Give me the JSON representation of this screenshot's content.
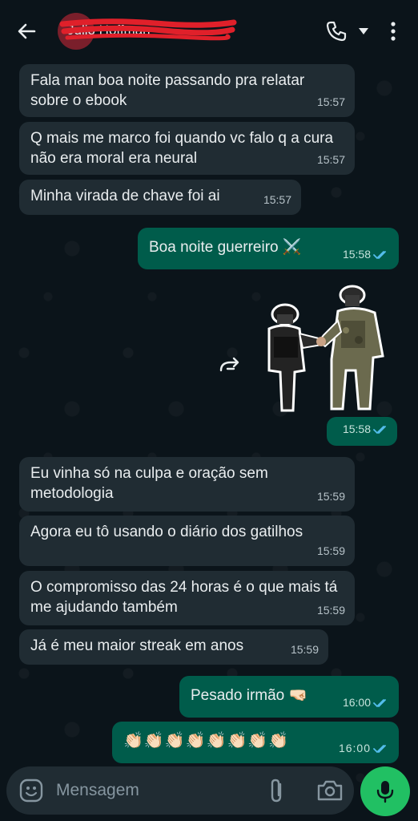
{
  "header": {
    "contact_name": "Julio Hoffman",
    "icons": [
      "back-arrow-icon",
      "phone-icon",
      "caret-down-icon",
      "more-vert-icon"
    ]
  },
  "messages": [
    {
      "dir": "in",
      "text": "Fala man boa noite passando pra relatar sobre o ebook",
      "time": "15:57"
    },
    {
      "dir": "in",
      "text": "Q mais me marco foi quando vc falo q a cura não era moral era neural",
      "time": "15:57"
    },
    {
      "dir": "in",
      "text": "Minha virada de chave foi ai",
      "time": "15:57"
    },
    {
      "dir": "out",
      "text": "Boa noite guerreiro ⚔️",
      "time": "15:58"
    },
    {
      "dir": "out",
      "type": "sticker",
      "time": "15:58"
    },
    {
      "dir": "in",
      "text": "Eu vinha só na culpa e oração sem metodologia",
      "time": "15:59"
    },
    {
      "dir": "in",
      "text": "Agora eu tô usando o diário dos gatilhos",
      "time": "15:59"
    },
    {
      "dir": "in",
      "text": "O compromisso das 24 horas é o que mais tá me ajudando também",
      "time": "15:59"
    },
    {
      "dir": "in",
      "text": "Já é meu maior streak em anos",
      "time": "15:59"
    },
    {
      "dir": "out",
      "text": "Pesado irmão 🤜🏻",
      "time": "16:00"
    },
    {
      "dir": "out",
      "text": "👏🏻👏🏻👏🏻👏🏻👏🏻👏🏻👏🏻👏🏻",
      "time": "16:00"
    }
  ],
  "composer": {
    "placeholder": "Mensagem",
    "icons": [
      "emoji-icon",
      "attach-icon",
      "camera-icon",
      "mic-icon"
    ]
  },
  "colors": {
    "background": "#0b141a",
    "incoming": "#202c33",
    "outgoing": "#005c4b",
    "read_ticks": "#53bdeb",
    "mic_button": "#21c063"
  }
}
